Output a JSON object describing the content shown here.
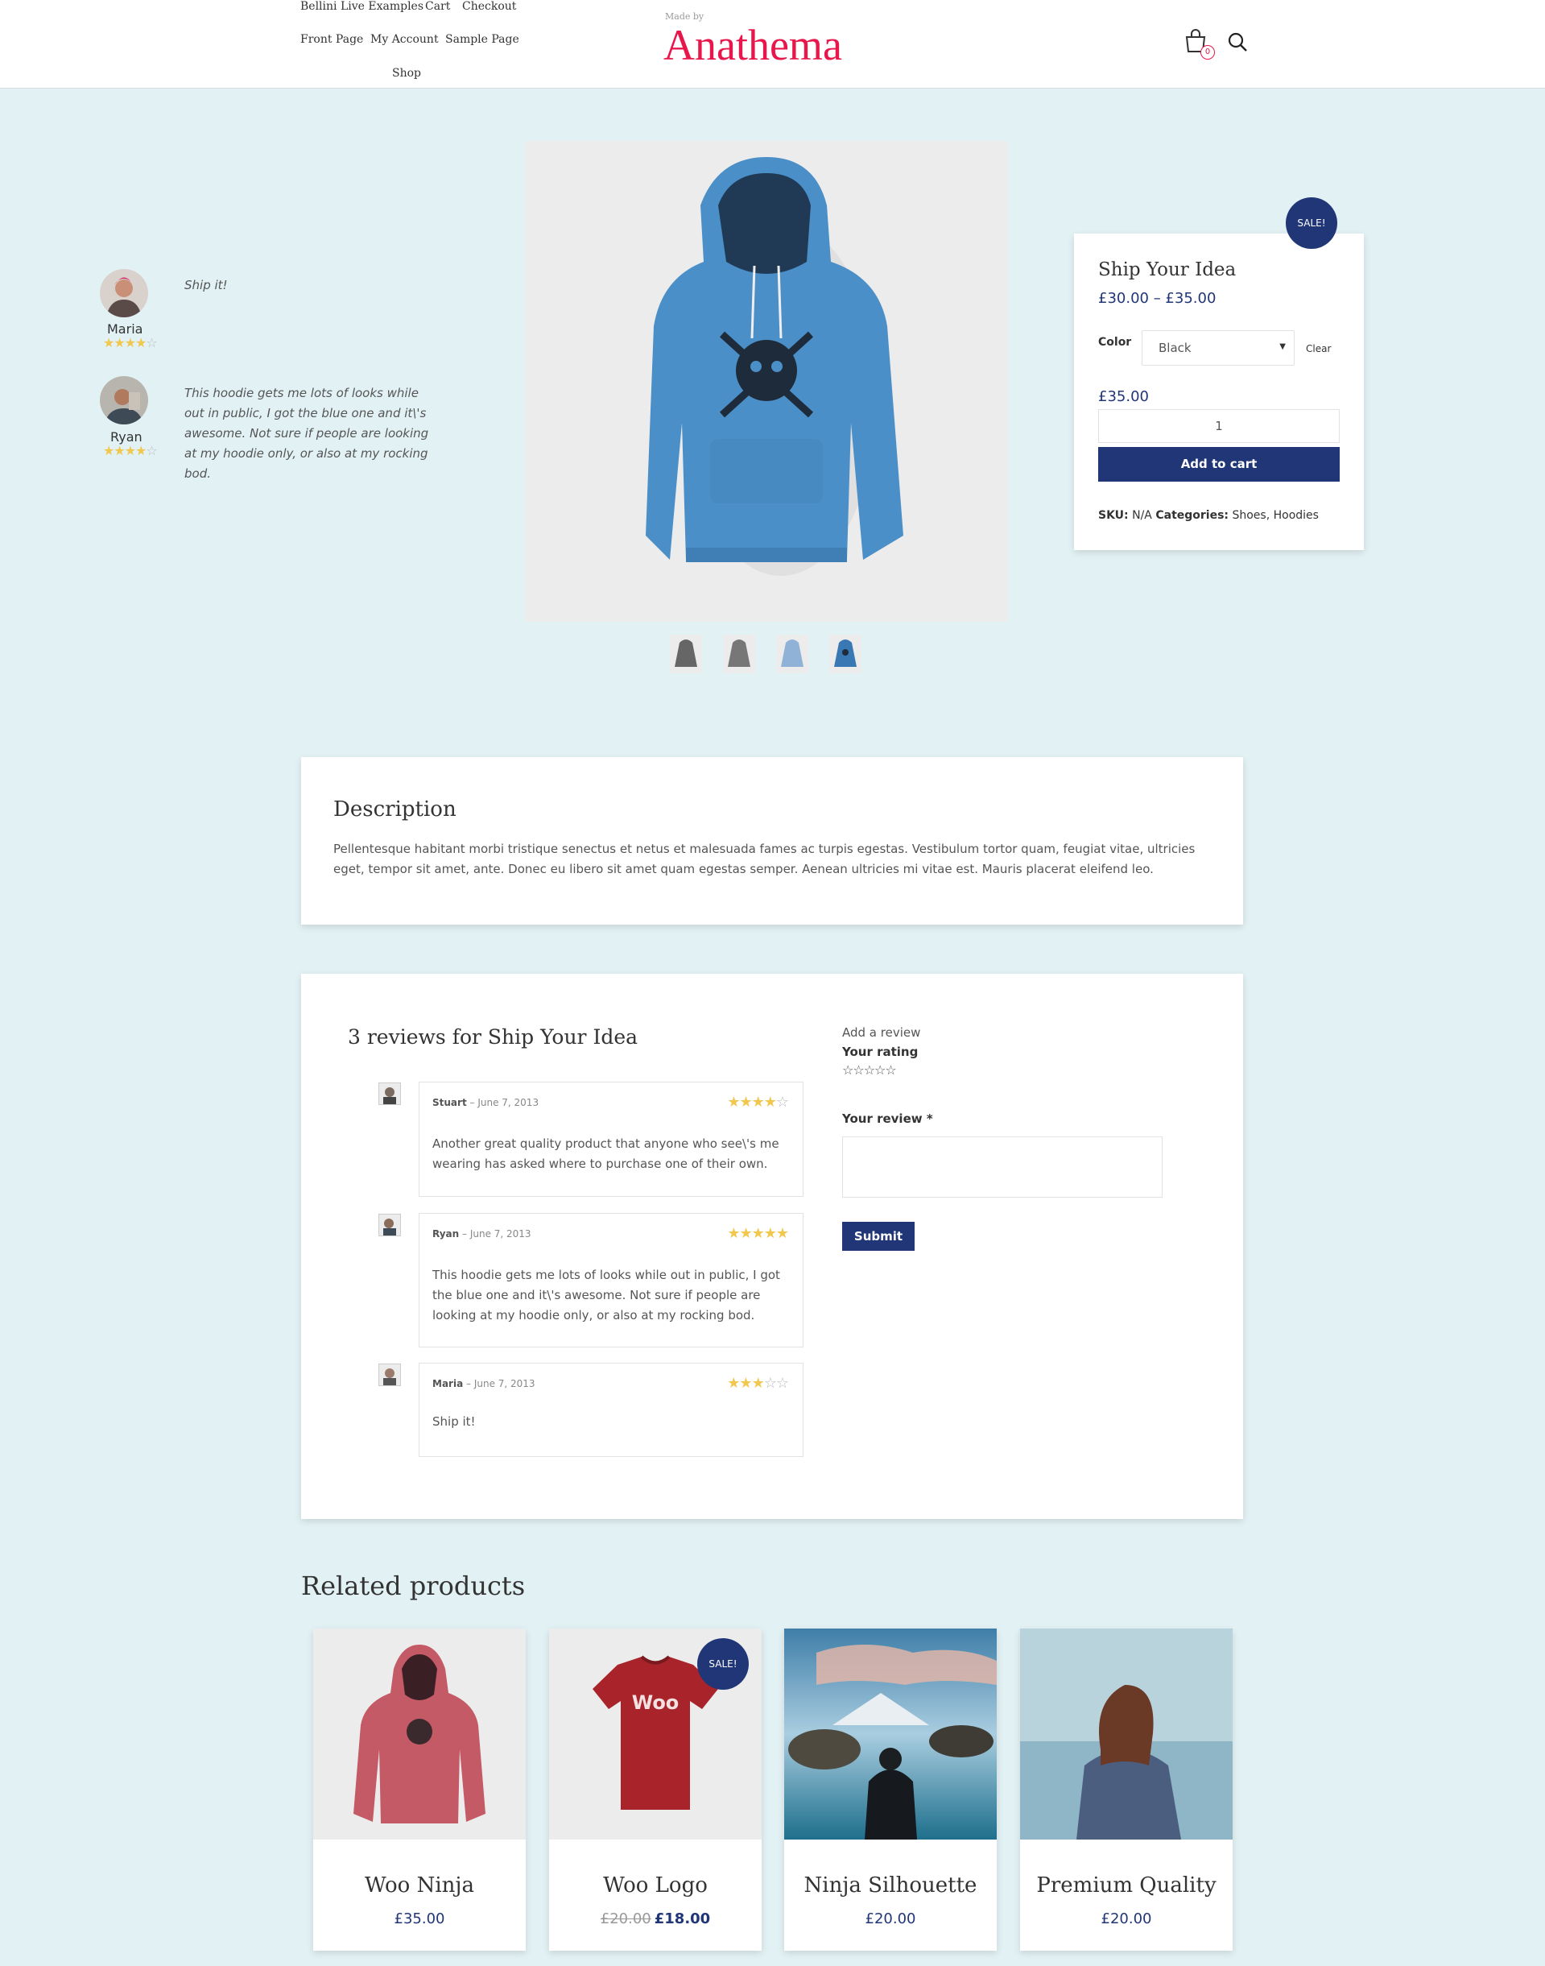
{
  "header": {
    "nav": [
      "Bellini Live Examples",
      "Cart",
      "Checkout",
      "Front Page",
      "My Account",
      "Sample Page",
      "Shop"
    ],
    "brand_small": "Made by",
    "brand": "Anathema",
    "cart_count": "0",
    "accent_color": "#e8174b"
  },
  "aside_reviews": [
    {
      "name": "Maria",
      "text": "Ship it!",
      "rating": 4
    },
    {
      "name": "Ryan",
      "text": "This hoodie gets me lots of looks while out in public, I got the blue one and it\\'s awesome. Not sure if people are looking at my hoodie only, or also at my rocking bod.",
      "rating": 4
    }
  ],
  "product": {
    "sale_badge": "SALE!",
    "title": "Ship Your Idea",
    "price_range": "£30.00 – £35.00",
    "color_label": "Color",
    "color_value": "Black",
    "clear_label": "Clear",
    "variation_price": "£35.00",
    "quantity": "1",
    "add_to_cart": "Add to cart",
    "sku_label": "SKU:",
    "sku_value": "N/A",
    "categories_label": "Categories:",
    "categories": "Shoes, Hoodies",
    "brand_color": "#213677"
  },
  "description": {
    "title": "Description",
    "text": "Pellentesque habitant morbi tristique senectus et netus et malesuada fames ac turpis egestas. Vestibulum tortor quam, feugiat vitae, ultricies eget, tempor sit amet, ante. Donec eu libero sit amet quam egestas semper. Aenean ultricies mi vitae est. Mauris placerat eleifend leo."
  },
  "reviews": {
    "title": "3 reviews for Ship Your Idea",
    "items": [
      {
        "author": "Stuart",
        "date": "– June 7, 2013",
        "rating": 4,
        "text": "Another great quality product that anyone who see\\'s me wearing has asked where to purchase one of their own."
      },
      {
        "author": "Ryan",
        "date": "– June 7, 2013",
        "rating": 5,
        "text": "This hoodie gets me lots of looks while out in public, I got the blue one and it\\'s awesome. Not sure if people are looking at my hoodie only, or also at my rocking bod."
      },
      {
        "author": "Maria",
        "date": "– June 7, 2013",
        "rating": 3,
        "text": "Ship it!"
      }
    ],
    "add_review": "Add a review",
    "your_rating": "Your rating",
    "your_review": "Your review *",
    "submit": "Submit"
  },
  "related": {
    "title": "Related products",
    "items": [
      {
        "name": "Woo Ninja",
        "price": "£35.00"
      },
      {
        "name": "Woo Logo",
        "old_price": "£20.00",
        "price": "£18.00",
        "sale": "SALE!",
        "logo_text": "Woo"
      },
      {
        "name": "Ninja Silhouette",
        "price": "£20.00"
      },
      {
        "name": "Premium Quality",
        "price": "£20.00"
      }
    ]
  }
}
